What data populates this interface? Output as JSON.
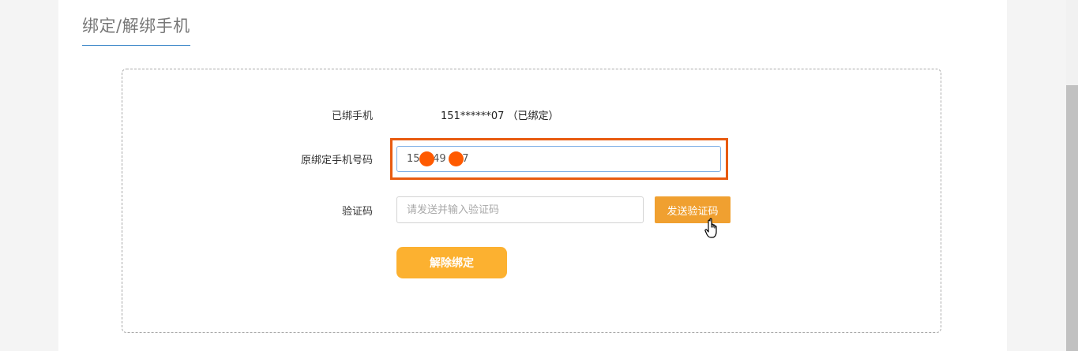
{
  "page": {
    "title": "绑定/解绑手机"
  },
  "form": {
    "bound_phone_label": "已绑手机",
    "bound_phone_value": "151******07 （已绑定）",
    "original_phone_label": "原绑定手机号码",
    "original_phone_value": "15  249 207",
    "verification_code_label": "验证码",
    "verification_code_placeholder": "请发送并输入验证码",
    "send_code_button": "发送验证码",
    "unbind_button": "解除绑定"
  },
  "colors": {
    "title_underline": "#3a86c8",
    "highlight_border": "#e85b10",
    "send_button_bg": "#f0a030",
    "unbind_button_bg": "#fcb130",
    "redaction_dot": "#ff5a00"
  },
  "icons": {
    "cursor": "hand-pointer-icon"
  }
}
